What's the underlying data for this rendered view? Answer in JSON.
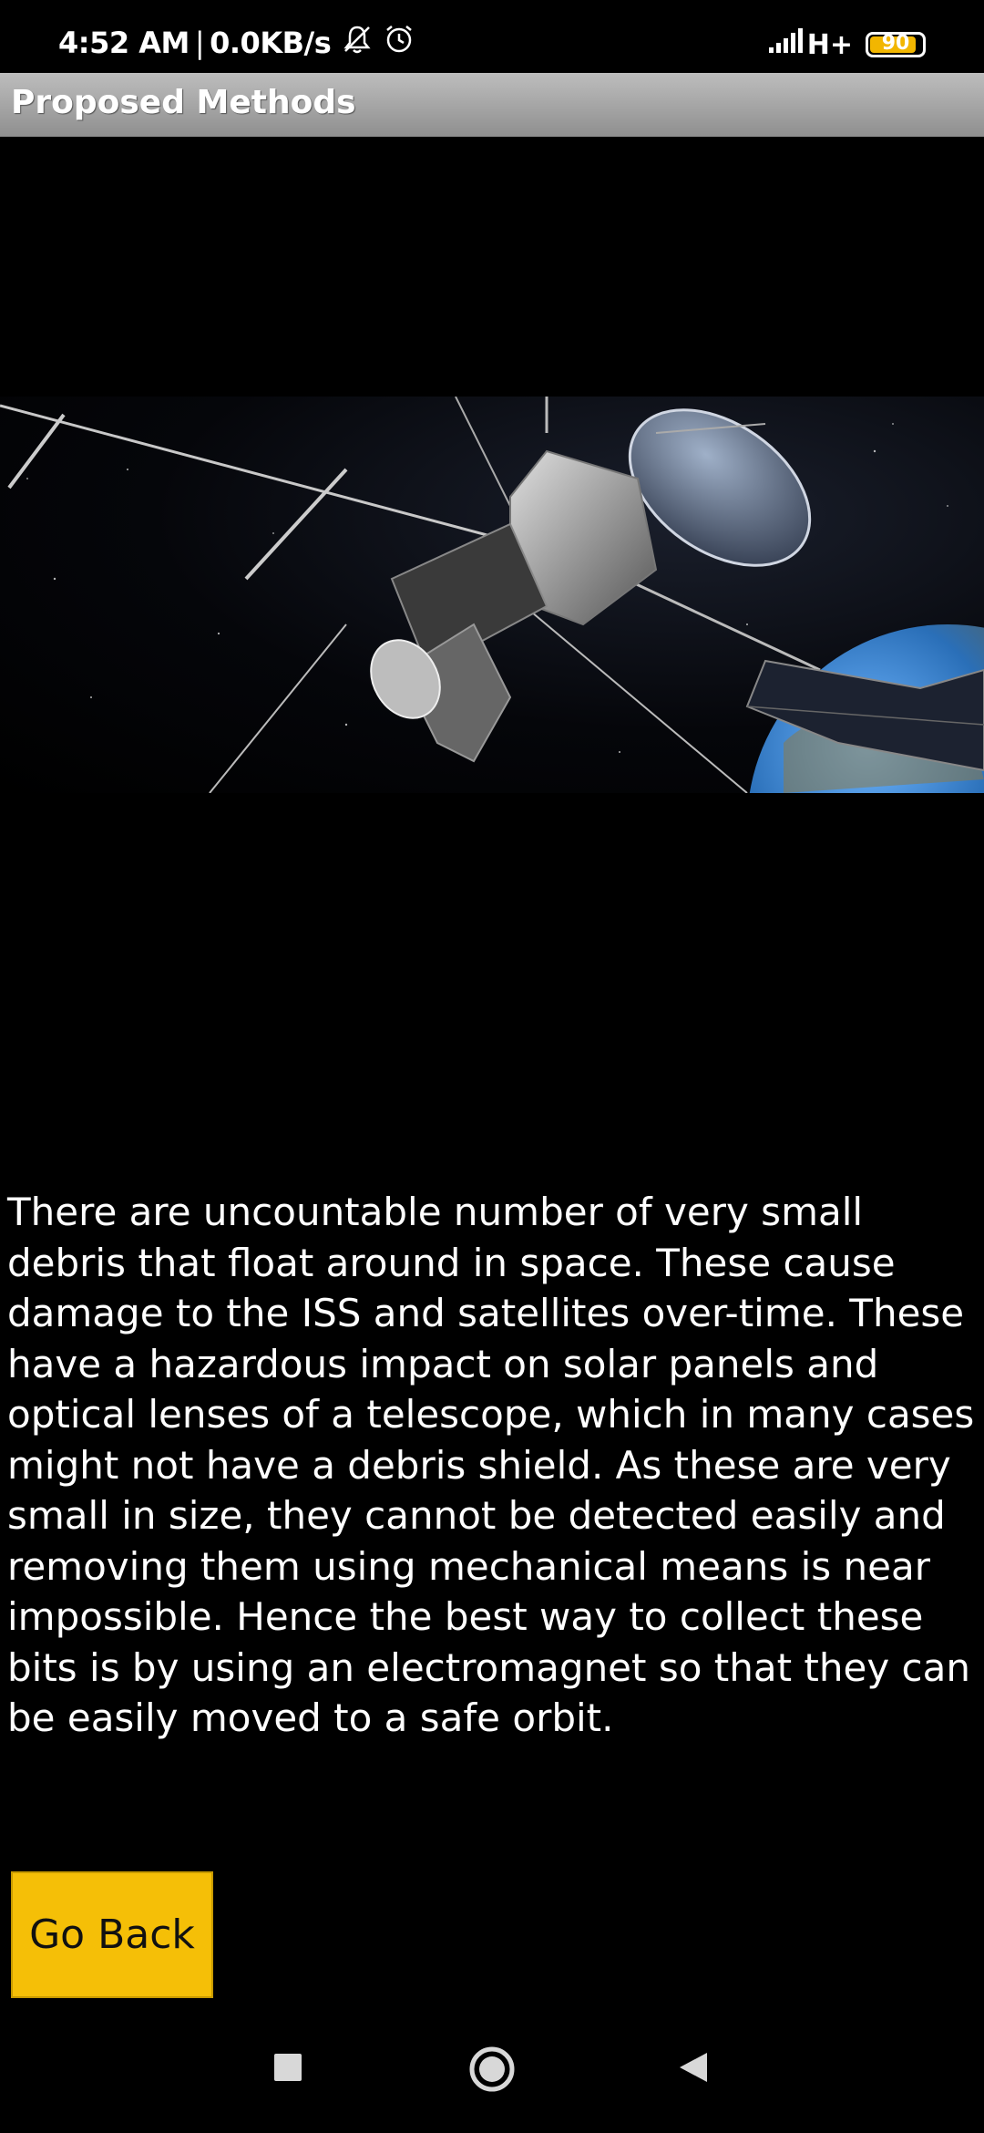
{
  "status_bar": {
    "time": "4:52 AM",
    "network_speed": "0.0KB/s",
    "signal_type": "H+",
    "battery_level": "90",
    "battery_fraction": 0.9,
    "icons": [
      "mute-icon",
      "alarm-icon",
      "signal-icon",
      "battery-icon"
    ]
  },
  "app_bar": {
    "title": "Proposed Methods"
  },
  "hero": {
    "icon": "satellite-image"
  },
  "content": {
    "paragraph": "There are uncountable number of very small debris that float around in space. These cause damage to the ISS and satellites over-time. These have a hazardous impact on solar panels and optical lenses of a telescope, which in many cases might not have a debris shield. As these are very small in size, they cannot be detected easily and removing them using mechanical means is near impossible. Hence the best way to collect these bits is by using an electromagnet so that they can be easily moved to a safe orbit."
  },
  "actions": {
    "go_back_label": "Go Back"
  },
  "nav_bar": {
    "icons": [
      "recents-icon",
      "home-icon",
      "back-icon"
    ]
  },
  "colors": {
    "background": "#000000",
    "app_bar": "#a6a6a6",
    "button": "#f5bf07",
    "battery": "#f2b600"
  }
}
